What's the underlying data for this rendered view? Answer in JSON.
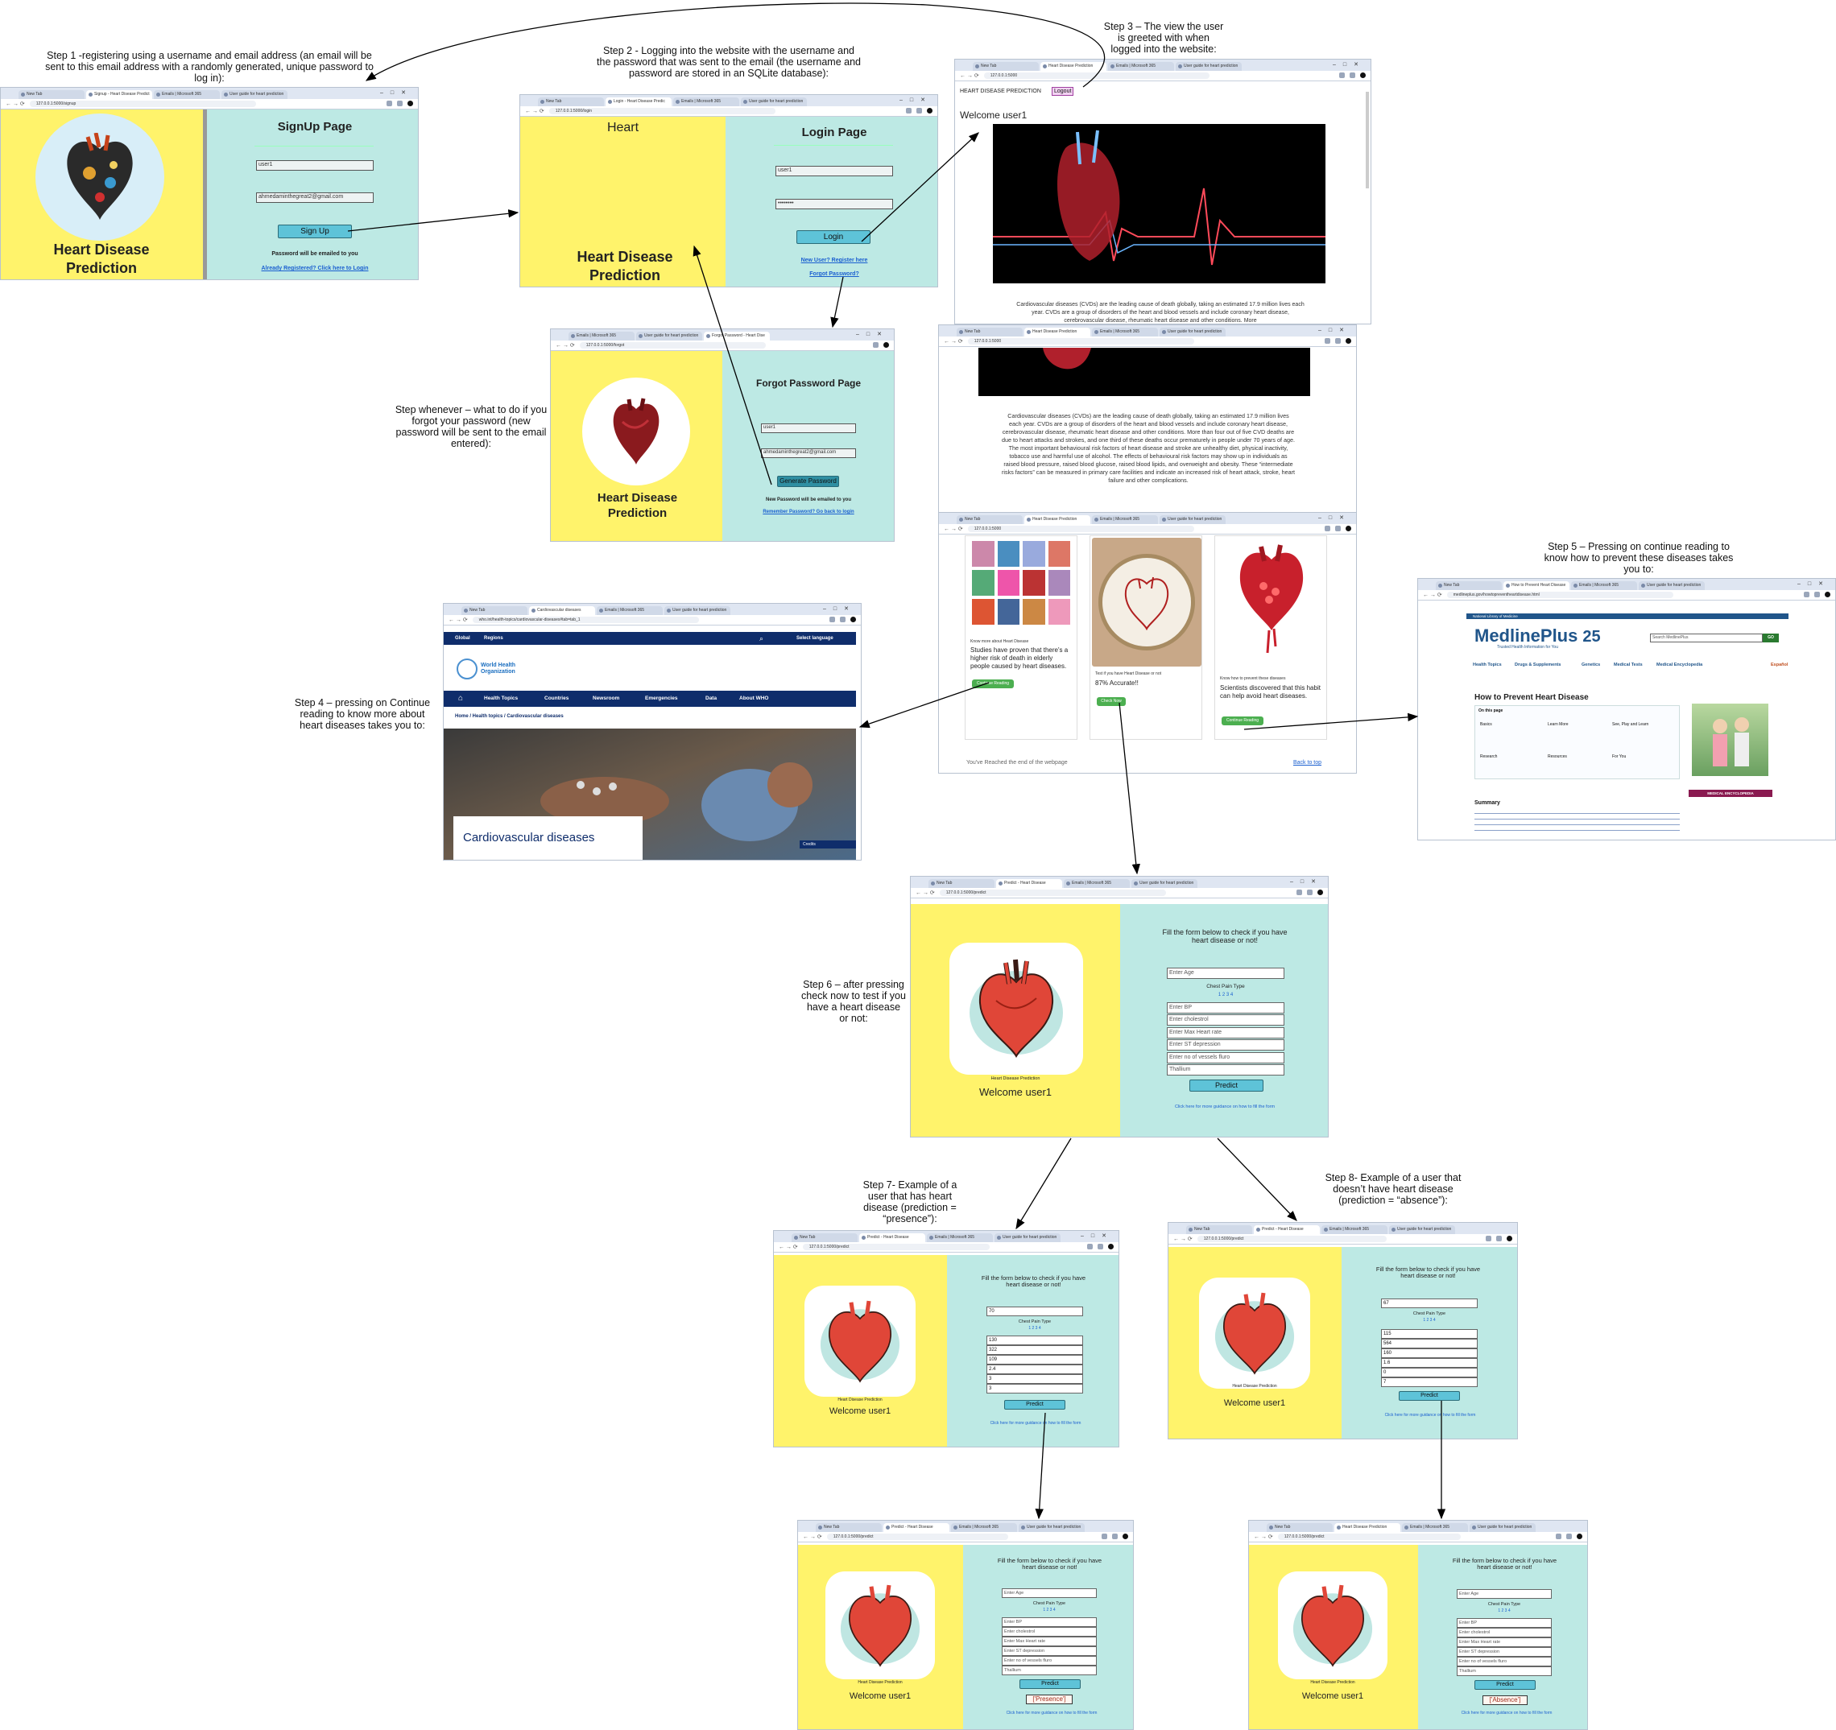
{
  "captions": {
    "step1": "Step 1 -registering using a username and email address (an email will be sent to this email address with a randomly generated, unique password to log in):",
    "step2": "Step 2 - Logging into the website with the username and the password that was sent to the email (the username and password are stored in an SQLite database):",
    "step3": "Step 3 – The view the user is greeted with when logged into the website:",
    "step_forgot": "Step whenever – what to do if you forgot your password (new password will be sent to the email entered):",
    "step4": "Step 4 – pressing on Continue reading to know more about heart diseases takes you to:",
    "step5": "Step 5 – Pressing on continue reading to know how to prevent these diseases takes you to:",
    "step6": "Step 6 – after pressing check now to test if you have a heart disease or not:",
    "step7": "Step 7- Example of a user that has heart disease (prediction = “presence”):",
    "step8": "Step 8- Example of a user that doesn’t have heart disease (prediction = “absence”):"
  },
  "browser": {
    "new_tab": "New Tab",
    "outlook_tab": "Emails | Microsoft 365",
    "guide_tab": "User guide for heart prediction",
    "signup_tab": "Signup - Heart Disease Predict",
    "login_tab": "Login - Heart Disease Predic",
    "home_tab": "Heart Disease Prediction",
    "forgot_tab": "Forgot Password - Heart Dise",
    "who_tab": "Cardiovascular diseases",
    "medline_tab": "How to Prevent Heart Disease",
    "predict_tab": "Predict - Heart Disease",
    "signup_url": "127.0.0.1:5000/signup",
    "login_url": "127.0.0.1:5000/login",
    "home_url": "127.0.0.1:5000",
    "forgot_url": "127.0.0.1:5000/forgot",
    "who_url": "who.int/health-topics/cardiovascular-diseases#tab=tab_1",
    "medline_url": "medlineplus.gov/howtopreventheartdisease.html",
    "predict_url": "127.0.0.1:5000/predict"
  },
  "signup": {
    "app_title": "Heart Disease Prediction",
    "page_title": "SignUp Page",
    "username_value": "user1",
    "email_value": "ahmedaminthegreat2@gmail.com",
    "button": "Sign Up",
    "note": "Password will be emailed to you",
    "link": "Already Registered? Click here to Login"
  },
  "login": {
    "header_word": "Heart",
    "app_title": "Heart Disease Prediction",
    "page_title": "Login Page",
    "username_value": "user1",
    "password_value": "••••••••",
    "button": "Login",
    "register_link": "New User? Register here",
    "forgot_link": "Forgot Password?"
  },
  "forgot": {
    "app_title": "Heart Disease Prediction",
    "page_title": "Forgot Password Page",
    "username_value": "user1",
    "email_value": "ahmedaminthegreat2@gmail.com",
    "button": "Generate Password",
    "note": "New Password will be emailed to you",
    "link": "Remember Password? Go back to login"
  },
  "home": {
    "nav_title": "HEART DISEASE PREDICTION",
    "logout": "Logout",
    "welcome": "Welcome user1",
    "intro_short": "Cardiovascular diseases (CVDs) are the leading cause of death globally, taking an estimated 17.9 million lives each year. CVDs are a group of disorders of the heart and blood vessels and include coronary heart disease, cerebrovascular disease, rheumatic heart disease and other conditions. More",
    "intro_full": "Cardiovascular diseases (CVDs) are the leading cause of death globally, taking an estimated 17.9 million lives each year. CVDs are a group of disorders of the heart and blood vessels and include coronary heart disease, cerebrovascular disease, rheumatic heart disease and other conditions. More than four out of five CVD deaths are due to heart attacks and strokes, and one third of these deaths occur prematurely in people under 70 years of age. The most important behavioural risk factors of heart disease and stroke are unhealthy diet, physical inactivity, tobacco use and harmful use of alcohol. The effects of behavioural risk factors may show up in individuals as raised blood pressure, raised blood glucose, raised blood lipids, and overweight and obesity. These “intermediate risks factors” can be measured in primary care facilities and indicate an increased risk of heart attack, stroke, heart failure and other complications.",
    "cards": [
      {
        "kicker": "Know more about Heart Disease",
        "text": "Studies have proven that there's a higher risk of death in elderly people caused by heart diseases.",
        "button": "Continue Reading"
      },
      {
        "kicker": "Test if you have Heart Disease or not",
        "text": "87% Accurate!!",
        "button": "Check Now"
      },
      {
        "kicker": "Know how to prevent these diseases",
        "text": "Scientists discovered that this habit can help avoid heart diseases.",
        "button": "Continue Reading"
      }
    ],
    "end_text": "You've Reached the end of the webpage",
    "back_top": "Back to top"
  },
  "who": {
    "global": "Global",
    "regions": "Regions",
    "lang": "Select language",
    "org": "World Health Organization",
    "nav": [
      "Health Topics",
      "Countries",
      "Newsroom",
      "Emergencies",
      "Data",
      "About WHO"
    ],
    "breadcrumb": "Home / Health topics / Cardiovascular diseases",
    "hero_title": "Cardiovascular diseases",
    "credits": "Credits"
  },
  "medline": {
    "nlm": "National Library of Medicine",
    "brand": "MedlinePlus",
    "tagline": "Trusted Health Information for You",
    "years": "25",
    "search_placeholder": "Search MedlinePlus",
    "go": "GO",
    "nav": [
      "Health Topics",
      "Drugs & Supplements",
      "Genetics",
      "Medical Tests",
      "Medical Encyclopedia"
    ],
    "lang": "Español",
    "page_title": "How to Prevent Heart Disease",
    "on_this_page": "On this page",
    "columns": [
      "Basics",
      "Learn More",
      "See, Play and Learn",
      "Research",
      "Resources",
      "For You"
    ],
    "summary": "Summary",
    "encyclopedia": "MEDICAL ENCYCLOPEDIA"
  },
  "predict": {
    "app_title": "Heart Disease Prediction",
    "welcome": "Welcome user1",
    "form_title": "Fill the form below to check if you have heart disease or not!",
    "age_placeholder": "Enter Age",
    "chest_label": "Chest Pain Type",
    "chest_options": "1  2  3  4",
    "placeholders": [
      "Enter BP",
      "Enter cholestrol",
      "Enter Max Heart rate",
      "Enter ST depression",
      "Enter no of vessels fluro",
      "Thallium"
    ],
    "button": "Predict",
    "help_link": "Click here for more guidance on how to fill the form",
    "presence_values": [
      "70",
      "130",
      "322",
      "109",
      "2.4",
      "3",
      "3"
    ],
    "absence_values": [
      "67",
      "115",
      "564",
      "160",
      "1.6",
      "0",
      "7"
    ],
    "presence_result": "['Presence']",
    "absence_result": "['Absence']"
  },
  "colors": {
    "yellow": "#fff36b",
    "cyan": "#bde9e4",
    "button": "#5ec3d8",
    "who_navy": "#0f2d6b",
    "medline_blue": "#20558a"
  },
  "icons": [
    "heart-illustration",
    "heart-icon",
    "search-icon",
    "home-icon",
    "arrow-icon"
  ]
}
